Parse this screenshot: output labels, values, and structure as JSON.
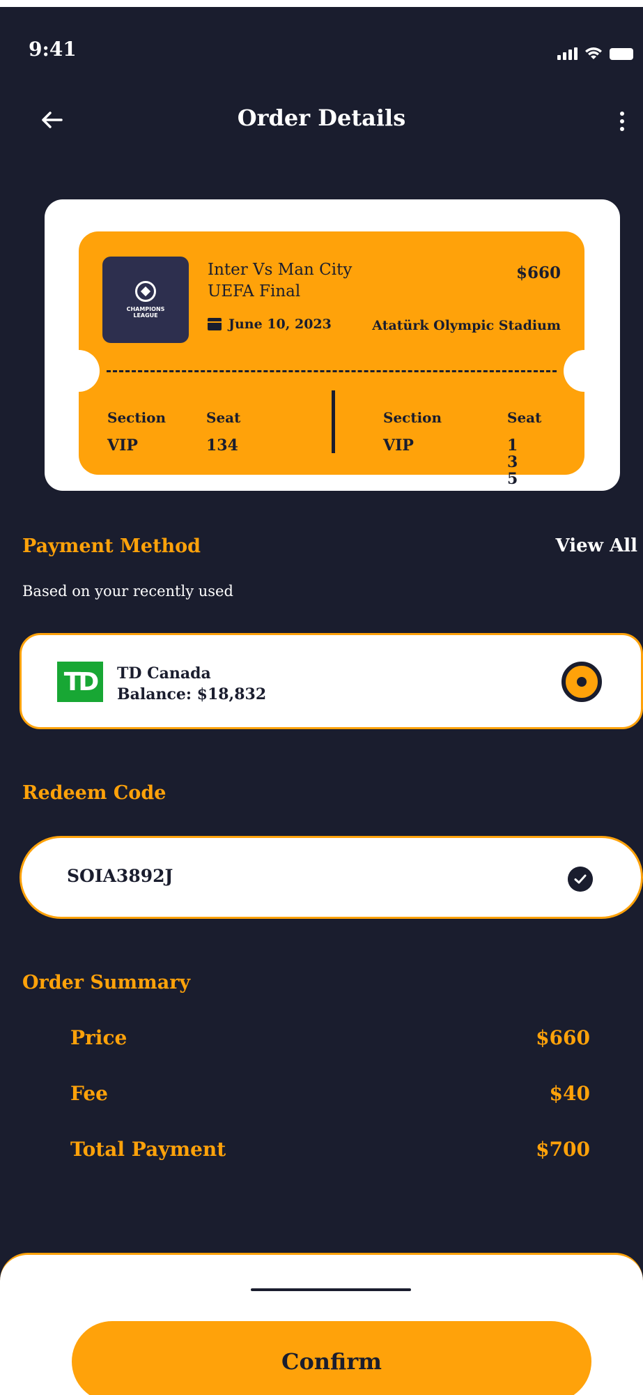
{
  "status_bar": {
    "time": "9:41"
  },
  "header": {
    "title": "Order Details"
  },
  "ticket": {
    "logo_text": "CHAMPIONS LEAGUE",
    "match_line1": "Inter Vs Man City",
    "match_line2": "UEFA Final",
    "price": "$660",
    "date": "June 10, 2023",
    "venue": "Atatürk Olympic Stadium",
    "left": {
      "section_label": "Section",
      "section_value": "VIP",
      "seat_label": "Seat",
      "seat_value": "134"
    },
    "right": {
      "section_label": "Section",
      "section_value": "VIP",
      "seat_label": "Seat",
      "seat_value": "135"
    }
  },
  "payment": {
    "title": "Payment Method",
    "view_all": "View All",
    "subtitle": "Based on your recently used",
    "bank_logo": "TD",
    "bank_name": "TD Canada",
    "balance": "Balance: $18,832",
    "selected": true
  },
  "redeem": {
    "title": "Redeem Code",
    "code": "SOIA3892J",
    "valid": true
  },
  "summary": {
    "title": "Order Summary",
    "rows": [
      {
        "label": "Price",
        "value": "$660"
      },
      {
        "label": "Fee",
        "value": "$40"
      },
      {
        "label": "Total Payment",
        "value": "$700"
      }
    ]
  },
  "footer": {
    "confirm_label": "Confirm"
  },
  "colors": {
    "accent": "#ffa20a",
    "background": "#1a1d2e",
    "td_green": "#18a734"
  },
  "icons": [
    "back-arrow-icon",
    "more-vertical-icon",
    "calendar-icon",
    "radio-selected-icon",
    "check-circle-icon",
    "signal-icon",
    "wifi-icon",
    "battery-icon"
  ]
}
